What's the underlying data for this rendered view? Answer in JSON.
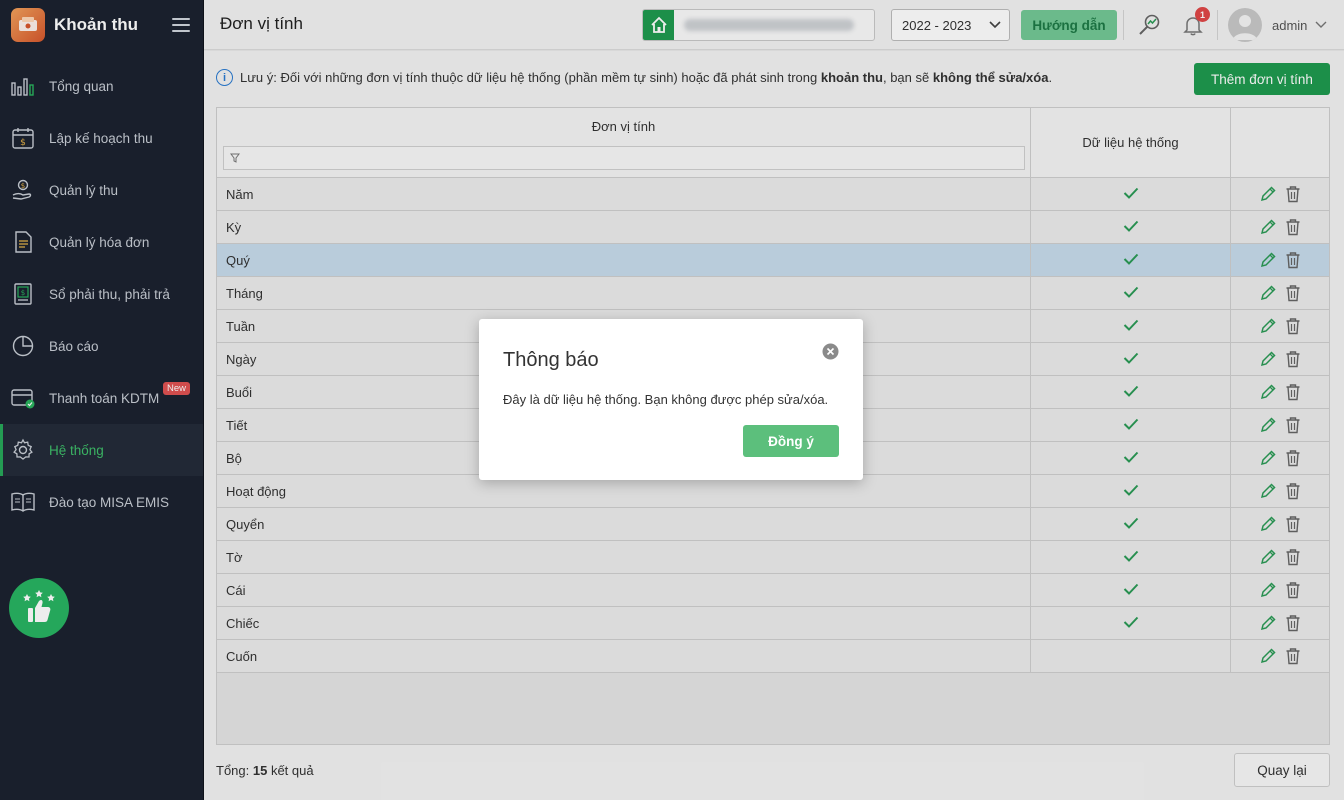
{
  "app": {
    "title": "Khoản thu"
  },
  "sidebar": {
    "items": [
      {
        "label": "Tổng quan",
        "icon": "bar-chart-icon"
      },
      {
        "label": "Lập kế hoạch thu",
        "icon": "calendar-money-icon"
      },
      {
        "label": "Quản lý thu",
        "icon": "hand-coin-icon"
      },
      {
        "label": "Quản lý hóa đơn",
        "icon": "document-icon"
      },
      {
        "label": "Sổ phải thu, phải trả",
        "icon": "ledger-icon"
      },
      {
        "label": "Báo cáo",
        "icon": "pie-chart-icon"
      },
      {
        "label": "Thanh toán KDTM",
        "icon": "payment-card-icon",
        "badge": "New"
      },
      {
        "label": "Hệ thống",
        "icon": "gear-icon",
        "active": true
      },
      {
        "label": "Đào tạo MISA EMIS",
        "icon": "book-icon"
      }
    ]
  },
  "topbar": {
    "page_title": "Đơn vị tính",
    "year": "2022 - 2023",
    "guide_label": "Hướng dẫn",
    "notification_count": "1",
    "username": "admin"
  },
  "main": {
    "note_prefix": "Lưu ý: Đối với những đơn vị tính thuộc dữ liệu hệ thống (phần mềm tự sinh) hoặc đã phát sinh trong ",
    "note_bold1": "khoản thu",
    "note_middle": ", bạn sẽ ",
    "note_bold2": "không thể sửa/xóa",
    "note_suffix": ".",
    "add_button": "Thêm đơn vị tính",
    "columns": {
      "name": "Đơn vị tính",
      "system": "Dữ liệu hệ thống"
    },
    "rows": [
      {
        "name": "Năm",
        "system": true
      },
      {
        "name": "Kỳ",
        "system": true
      },
      {
        "name": "Quý",
        "system": true,
        "selected": true
      },
      {
        "name": "Tháng",
        "system": true
      },
      {
        "name": "Tuần",
        "system": true
      },
      {
        "name": "Ngày",
        "system": true
      },
      {
        "name": "Buổi",
        "system": true
      },
      {
        "name": "Tiết",
        "system": true
      },
      {
        "name": "Bộ",
        "system": true
      },
      {
        "name": "Hoạt động",
        "system": true
      },
      {
        "name": "Quyển",
        "system": true
      },
      {
        "name": "Tờ",
        "system": true
      },
      {
        "name": "Cái",
        "system": true
      },
      {
        "name": "Chiếc",
        "system": true
      },
      {
        "name": "Cuốn",
        "system": false
      }
    ],
    "total_prefix": "Tổng: ",
    "total_count": "15",
    "total_suffix": " kết quả",
    "reload_label": "Quay lại"
  },
  "dialog": {
    "title": "Thông báo",
    "message": "Đây là dữ liệu hệ thống. Bạn không được phép sửa/xóa.",
    "ok_label": "Đồng ý"
  },
  "colors": {
    "primary_green": "#1f9a4f",
    "check_green": "#2a9a55",
    "sidebar_bg": "#1b2230",
    "selected_row": "#c8dcec"
  }
}
